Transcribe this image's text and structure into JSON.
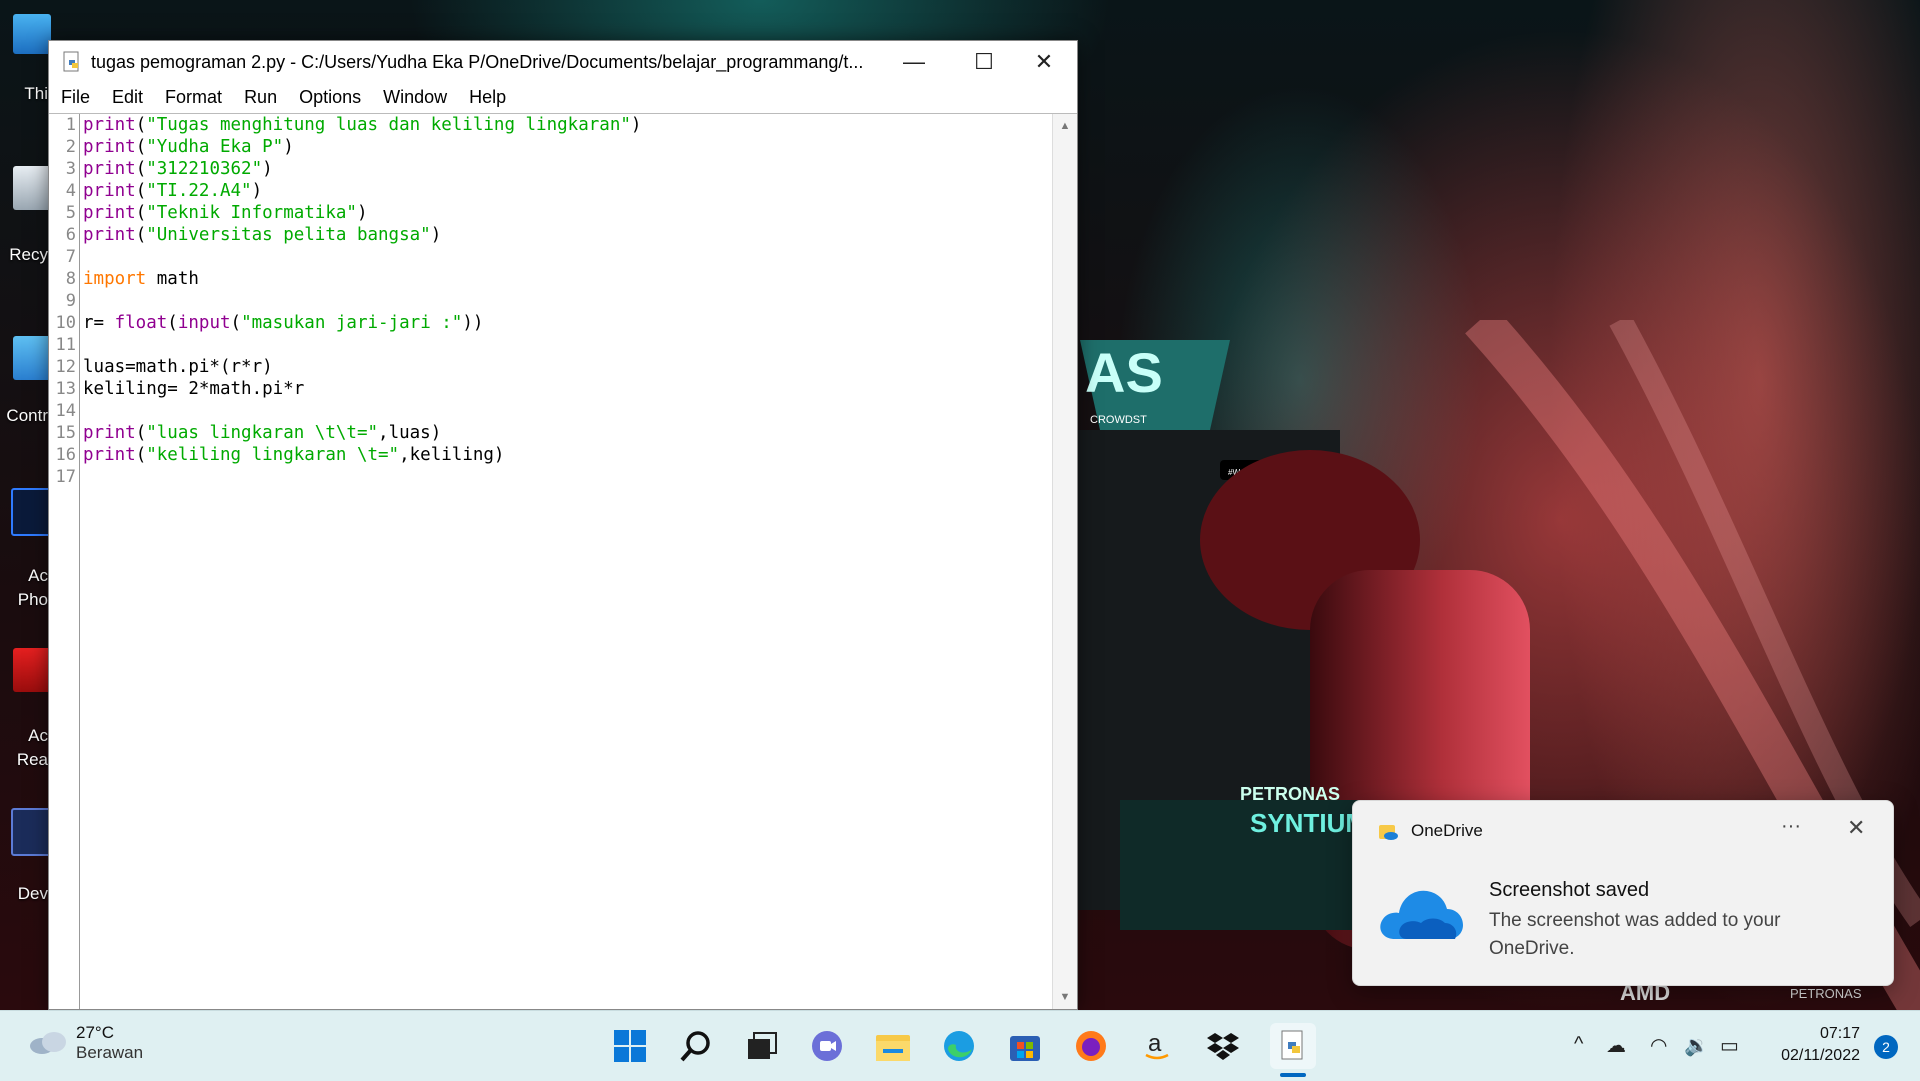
{
  "desktop": {
    "icons": [
      {
        "label": "Thi"
      },
      {
        "label": "Recy"
      },
      {
        "label": "Contr"
      },
      {
        "label": "Ac\nPho"
      },
      {
        "label": "Ac\nRea"
      },
      {
        "label": "Dev"
      }
    ]
  },
  "window": {
    "title": "tugas pemograman 2.py - C:/Users/Yudha Eka P/OneDrive/Documents/belajar_programmang/t...",
    "minimize": "—",
    "maximize": "☐",
    "close": "✕"
  },
  "menu": [
    "File",
    "Edit",
    "Format",
    "Run",
    "Options",
    "Window",
    "Help"
  ],
  "editor": {
    "line_numbers": [
      "1",
      "2",
      "3",
      "4",
      "5",
      "6",
      "7",
      "8",
      "9",
      "10",
      "11",
      "12",
      "13",
      "14",
      "15",
      "16",
      "17"
    ],
    "lines": [
      [
        {
          "t": "print",
          "c": "bi"
        },
        {
          "t": "(",
          "c": ""
        },
        {
          "t": "\"Tugas menghitung luas dan keliling lingkaran\"",
          "c": "st"
        },
        {
          "t": ")",
          "c": ""
        }
      ],
      [
        {
          "t": "print",
          "c": "bi"
        },
        {
          "t": "(",
          "c": ""
        },
        {
          "t": "\"Yudha Eka P\"",
          "c": "st"
        },
        {
          "t": ")",
          "c": ""
        }
      ],
      [
        {
          "t": "print",
          "c": "bi"
        },
        {
          "t": "(",
          "c": ""
        },
        {
          "t": "\"312210362\"",
          "c": "st"
        },
        {
          "t": ")",
          "c": ""
        }
      ],
      [
        {
          "t": "print",
          "c": "bi"
        },
        {
          "t": "(",
          "c": ""
        },
        {
          "t": "\"TI.22.A4\"",
          "c": "st"
        },
        {
          "t": ")",
          "c": ""
        }
      ],
      [
        {
          "t": "print",
          "c": "bi"
        },
        {
          "t": "(",
          "c": ""
        },
        {
          "t": "\"Teknik Informatika\"",
          "c": "st"
        },
        {
          "t": ")",
          "c": ""
        }
      ],
      [
        {
          "t": "print",
          "c": "bi"
        },
        {
          "t": "(",
          "c": ""
        },
        {
          "t": "\"Universitas pelita bangsa\"",
          "c": "st"
        },
        {
          "t": ")",
          "c": ""
        }
      ],
      [],
      [
        {
          "t": "import",
          "c": "kw"
        },
        {
          "t": " math",
          "c": ""
        }
      ],
      [],
      [
        {
          "t": "r= ",
          "c": ""
        },
        {
          "t": "float",
          "c": "bi"
        },
        {
          "t": "(",
          "c": ""
        },
        {
          "t": "input",
          "c": "bi"
        },
        {
          "t": "(",
          "c": ""
        },
        {
          "t": "\"masukan jari-jari :\"",
          "c": "st"
        },
        {
          "t": "))",
          "c": ""
        }
      ],
      [],
      [
        {
          "t": "luas=math.pi*(r*r)",
          "c": ""
        }
      ],
      [
        {
          "t": "keliling= 2*math.pi*r",
          "c": ""
        }
      ],
      [],
      [
        {
          "t": "print",
          "c": "bi"
        },
        {
          "t": "(",
          "c": ""
        },
        {
          "t": "\"luas lingkaran \\t\\t=\"",
          "c": "st"
        },
        {
          "t": ",luas)",
          "c": ""
        }
      ],
      [
        {
          "t": "print",
          "c": "bi"
        },
        {
          "t": "(",
          "c": ""
        },
        {
          "t": "\"keliling lingkaran \\t=\"",
          "c": "st"
        },
        {
          "t": ",keliling)",
          "c": ""
        }
      ],
      []
    ]
  },
  "taskbar": {
    "weather_temp": "27°C",
    "weather_desc": "Berawan",
    "apps": [
      "start-icon",
      "search-icon",
      "task-view-icon",
      "chat-icon",
      "file-explorer-icon",
      "edge-icon",
      "store-icon",
      "firefox-icon",
      "amazon-icon",
      "dropbox-icon",
      "python-idle-icon"
    ],
    "time": "07:17",
    "date": "02/11/2022",
    "notifications": "2"
  },
  "toast": {
    "app_name": "OneDrive",
    "more": "···",
    "close": "✕",
    "title": "Screenshot saved",
    "body": "The screenshot was added to your OneDrive."
  },
  "wallpaper_text": {
    "team": "AS",
    "sponsor1": "PETRONAS",
    "sponsor2": "SYNTIUM",
    "sponsor3": "AMD",
    "sponsor4": "PETRONAS",
    "sponsor5": "#WeRaceAsOne",
    "sponsor6": "CROWDST"
  },
  "colors": {
    "keyword": "#ff7700",
    "builtin": "#900090",
    "string": "#00aa00",
    "accent": "#0067c0",
    "taskbar": "#dff0f2"
  }
}
